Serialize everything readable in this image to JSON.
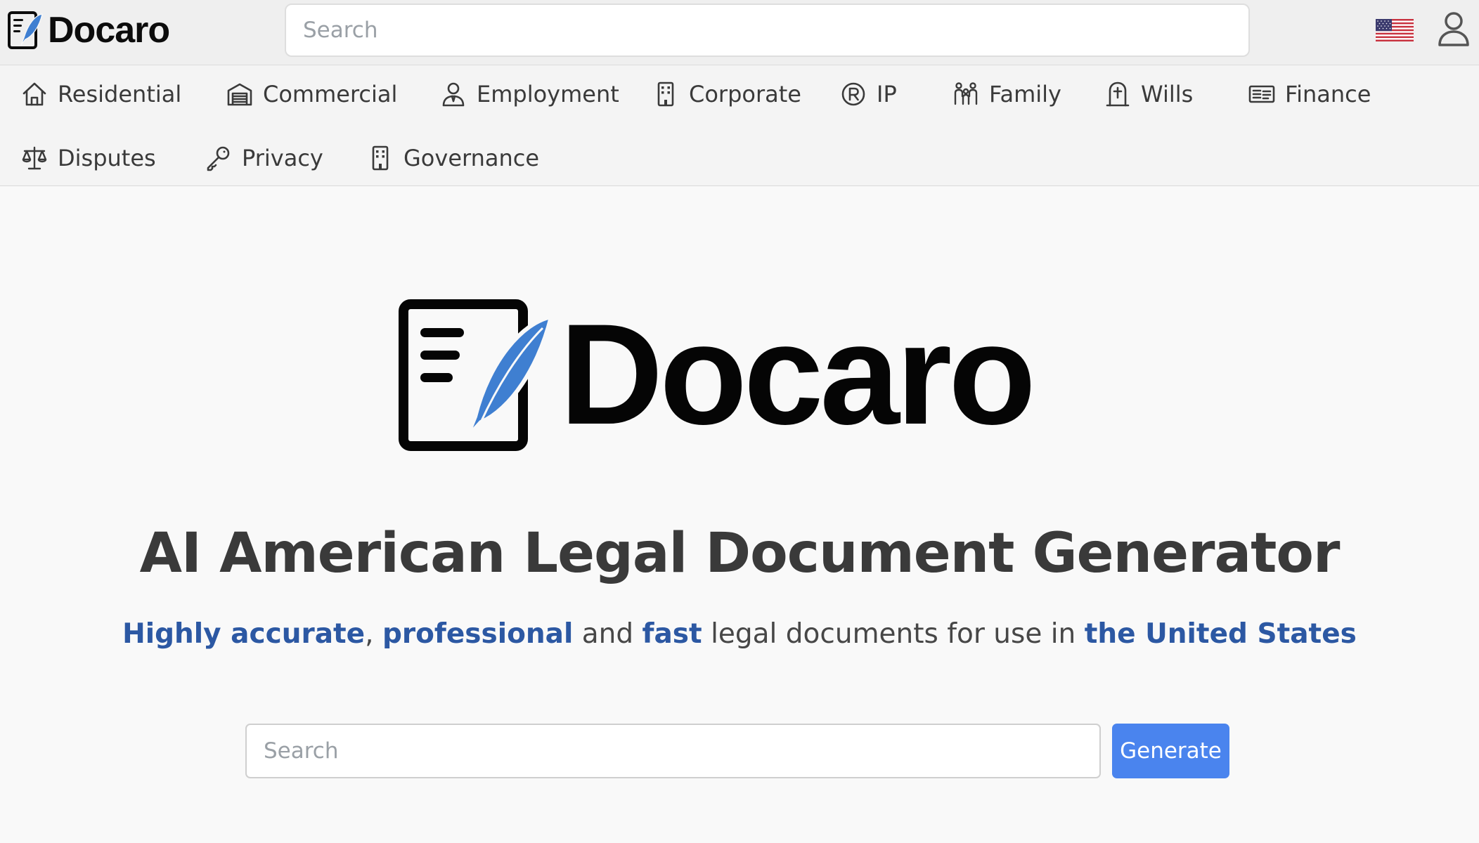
{
  "brand": {
    "name": "Docaro",
    "ink_color": "#0c0c0c",
    "quill_color": "#3f7fd1"
  },
  "header": {
    "search_placeholder": "Search",
    "flag_icon": "us-flag-icon",
    "user_icon": "user-icon"
  },
  "categories": [
    {
      "label": "Residential",
      "icon": "house-icon"
    },
    {
      "label": "Commercial",
      "icon": "warehouse-icon"
    },
    {
      "label": "Employment",
      "icon": "employee-icon"
    },
    {
      "label": "Corporate",
      "icon": "building-icon"
    },
    {
      "label": "IP",
      "icon": "registered-icon"
    },
    {
      "label": "Family",
      "icon": "family-icon"
    },
    {
      "label": "Wills",
      "icon": "headstone-icon"
    },
    {
      "label": "Finance",
      "icon": "cash-card-icon"
    },
    {
      "label": "Disputes",
      "icon": "scales-icon"
    },
    {
      "label": "Privacy",
      "icon": "key-icon"
    },
    {
      "label": "Governance",
      "icon": "building-icon"
    }
  ],
  "hero": {
    "logo_text": "Docaro",
    "headline": "AI American Legal Document Generator",
    "tagline": {
      "part1": "Highly accurate",
      "sep1": ", ",
      "part2": "professional",
      "sep2": " and ",
      "part3": "fast",
      "sep3": " legal documents for use in ",
      "part4": "the United States"
    },
    "search_placeholder": "Search",
    "generate_label": "Generate"
  },
  "colors": {
    "accent_text": "#2c58a3",
    "button": "#4a84ee",
    "page_bg": "#f9f9f9",
    "header_bg": "#efefef"
  }
}
